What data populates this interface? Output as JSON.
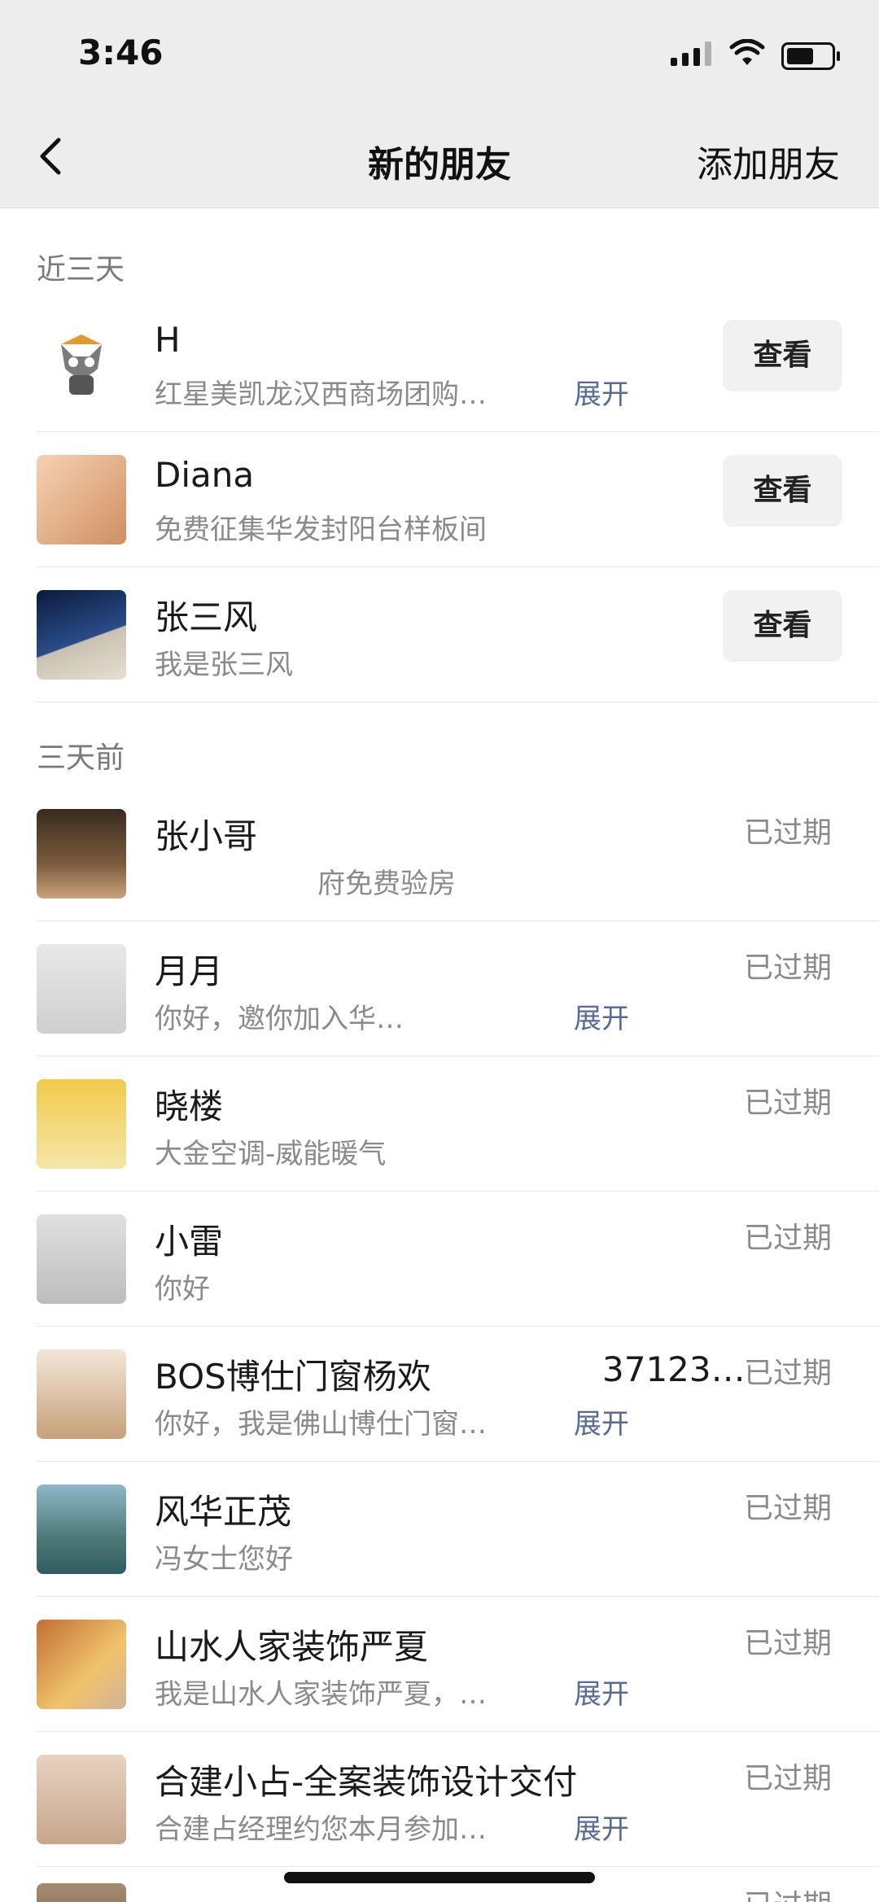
{
  "status": {
    "time": "3:46"
  },
  "nav": {
    "title": "新的朋友",
    "action": "添加朋友"
  },
  "sections": [
    {
      "label": "近三天"
    },
    {
      "label": "三天前"
    }
  ],
  "recent": [
    {
      "name": "H",
      "message": "红星美凯龙汉西商场团购…",
      "expand": "展开",
      "button": "查看",
      "avatar_color": "#d9d9d9"
    },
    {
      "name": "Diana",
      "message": "免费征集华发封阳台样板间",
      "expand": "",
      "button": "查看",
      "avatar_color": "#e7b58f"
    },
    {
      "name": "张三风",
      "message": "我是张三风",
      "expand": "",
      "button": "查看",
      "avatar_color": "#1c2a4d"
    }
  ],
  "older": [
    {
      "name": "张小哥",
      "message": "府免费验房",
      "expand": "",
      "status": "已过期",
      "avatar_color": "#7a5a3c"
    },
    {
      "name": "月月",
      "message": "你好，邀你加入华…",
      "expand": "展开",
      "status": "已过期",
      "avatar_color": "#d6d6d6"
    },
    {
      "name": "晓楼",
      "message": "大金空调-威能暖气",
      "expand": "",
      "status": "已过期",
      "avatar_color": "#f2c94c"
    },
    {
      "name": "小雷",
      "message": "你好",
      "expand": "",
      "status": "已过期",
      "avatar_color": "#c9c9c9"
    },
    {
      "name": "BOS博仕门窗杨欢",
      "name_tail": "37123…",
      "message": "你好，我是佛山博仕门窗…",
      "expand": "展开",
      "status": "已过期",
      "avatar_color": "#c7a07a"
    },
    {
      "name": "风华正茂",
      "message": "冯女士您好",
      "expand": "",
      "status": "已过期",
      "avatar_color": "#4d7a78"
    },
    {
      "name": "山水人家装饰严夏",
      "message": "我是山水人家装饰严夏，…",
      "expand": "展开",
      "status": "已过期",
      "avatar_color": "#c46e36"
    },
    {
      "name": "合建小占-全案装饰设计交付",
      "message": "合建占经理约您本月参加…",
      "expand": "展开",
      "status": "已过期",
      "avatar_color": "#c7a58b"
    },
    {
      "name": "",
      "message": "",
      "expand": "",
      "status": "已过期",
      "avatar_color": "#a58a6e"
    }
  ]
}
